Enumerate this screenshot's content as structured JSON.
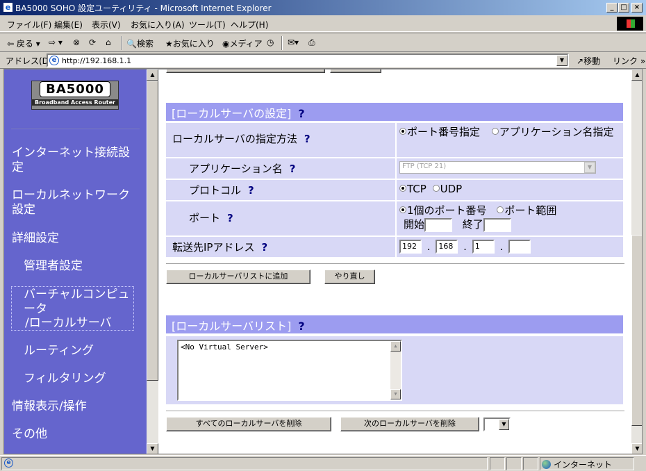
{
  "window": {
    "title": "BA5000 SOHO 設定ユーティリティ - Microsoft Internet Explorer"
  },
  "menu": {
    "items": [
      "ファイル(F)",
      "編集(E)",
      "表示(V)",
      "お気に入り(A)",
      "ツール(T)",
      "ヘルプ(H)"
    ]
  },
  "toolbar": {
    "back": "戻る",
    "search": "検索",
    "favorites": "お気に入り",
    "media": "メディア"
  },
  "address": {
    "label": "アドレス(D)",
    "url": "http://192.168.1.1",
    "go": "移動",
    "links": "リンク »"
  },
  "sidebar": {
    "logo": {
      "name": "BA5000",
      "sub": "Broadband Access Router"
    },
    "items": [
      "インターネット接続設定",
      "ローカルネットワーク設定",
      "詳細設定",
      "管理者設定",
      "バーチャルコンピュータ",
      "/ローカルサーバ",
      "ルーティング",
      "フィルタリング",
      "情報表示/操作",
      "その他"
    ]
  },
  "local_server": {
    "title": "[ローカルサーバの設定]",
    "help": "?",
    "method_label": "ローカルサーバの指定方法",
    "method_opt_port": "ポート番号指定",
    "method_opt_app": "アプリケーション名指定",
    "app_label": "アプリケーション名",
    "app_value": "FTP (TCP 21)",
    "protocol_label": "プロトコル",
    "protocol_tcp": "TCP",
    "protocol_udp": "UDP",
    "port_label": "ポート",
    "port_opt_single": "1個のポート番号",
    "port_opt_range": "ポート範囲",
    "port_start": "開始",
    "port_end": "終了",
    "dest_label": "転送先IPアドレス",
    "ip": [
      "192",
      "168",
      "1",
      ""
    ],
    "ip_dot": "."
  },
  "buttons": {
    "add": "ローカルサーバリストに追加",
    "reset": "やり直し",
    "delete_all": "すべてのローカルサーバを削除",
    "delete_next": "次のローカルサーバを削除"
  },
  "server_list": {
    "title": "[ローカルサーバリスト]",
    "empty_text": "<No Virtual Server>"
  },
  "status": {
    "zone": "インターネット"
  }
}
